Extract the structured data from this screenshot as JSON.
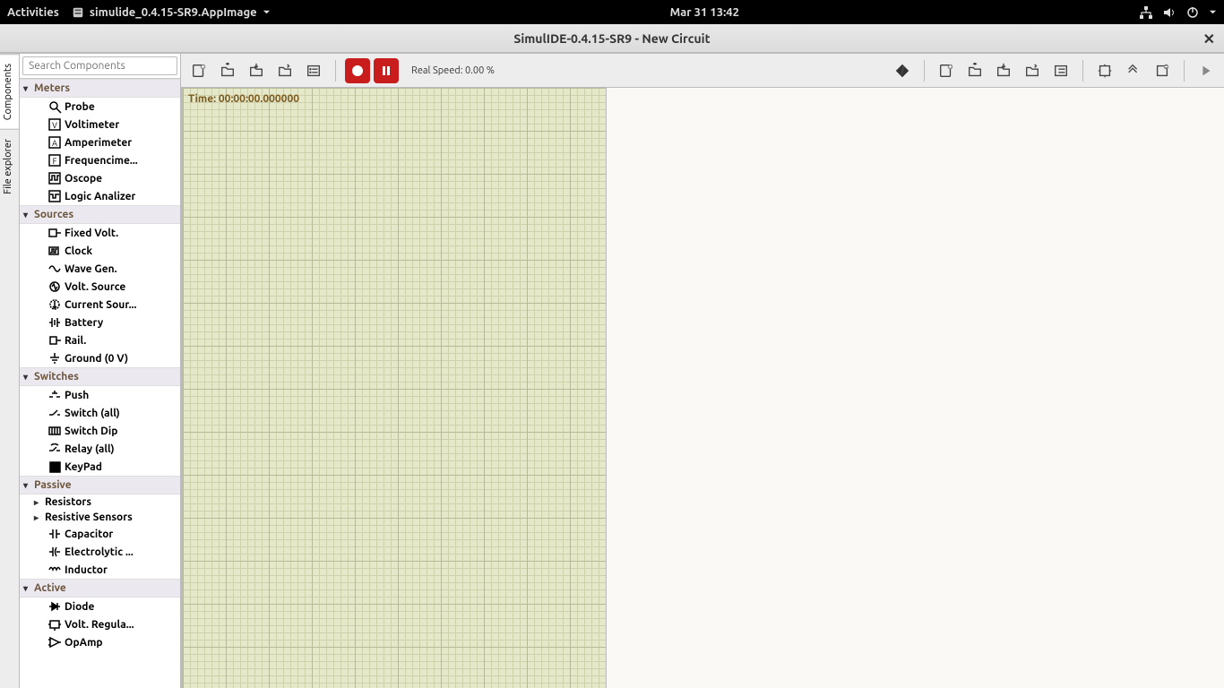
{
  "gnome": {
    "activities": "Activities",
    "app_name": "simulide_0.4.15-SR9.AppImage",
    "clock": "Mar 31  13:42"
  },
  "window": {
    "title": "SimulIDE-0.4.15-SR9  -  New Circuit"
  },
  "side_tabs": {
    "components": "Components",
    "file_explorer": "File explorer"
  },
  "search": {
    "placeholder": "Search Components"
  },
  "tree": [
    {
      "type": "cat",
      "label": "Meters",
      "icon": "meters"
    },
    {
      "type": "item",
      "label": "Probe",
      "icon": "probe"
    },
    {
      "type": "item",
      "label": "Voltimeter",
      "icon": "voltimeter"
    },
    {
      "type": "item",
      "label": "Amperimeter",
      "icon": "amperimeter"
    },
    {
      "type": "item",
      "label": "Frequencime...",
      "icon": "freq"
    },
    {
      "type": "item",
      "label": "Oscope",
      "icon": "oscope"
    },
    {
      "type": "item",
      "label": "Logic Analizer",
      "icon": "logic"
    },
    {
      "type": "cat",
      "label": "Sources",
      "icon": "sources"
    },
    {
      "type": "item",
      "label": "Fixed Volt.",
      "icon": "fixedv"
    },
    {
      "type": "item",
      "label": "Clock",
      "icon": "clock"
    },
    {
      "type": "item",
      "label": "Wave Gen.",
      "icon": "wave"
    },
    {
      "type": "item",
      "label": "Volt. Source",
      "icon": "vsource"
    },
    {
      "type": "item",
      "label": "Current Sour...",
      "icon": "csource"
    },
    {
      "type": "item",
      "label": "Battery",
      "icon": "battery"
    },
    {
      "type": "item",
      "label": "Rail.",
      "icon": "rail"
    },
    {
      "type": "item",
      "label": "Ground (0 V)",
      "icon": "ground"
    },
    {
      "type": "cat",
      "label": "Switches",
      "icon": "switches"
    },
    {
      "type": "item",
      "label": "Push",
      "icon": "push"
    },
    {
      "type": "item",
      "label": "Switch (all)",
      "icon": "switch"
    },
    {
      "type": "item",
      "label": "Switch Dip",
      "icon": "dip"
    },
    {
      "type": "item",
      "label": "Relay (all)",
      "icon": "relay"
    },
    {
      "type": "item",
      "label": "KeyPad",
      "icon": "keypad"
    },
    {
      "type": "cat",
      "label": "Passive",
      "icon": "passive"
    },
    {
      "type": "subcat",
      "label": "Resistors",
      "icon": "resistors"
    },
    {
      "type": "subcat",
      "label": "Resistive Sensors",
      "icon": "rsensors"
    },
    {
      "type": "item",
      "label": "Capacitor",
      "icon": "cap"
    },
    {
      "type": "item",
      "label": "Electrolytic ...",
      "icon": "ecap"
    },
    {
      "type": "item",
      "label": "Inductor",
      "icon": "inductor"
    },
    {
      "type": "cat",
      "label": "Active",
      "icon": "active"
    },
    {
      "type": "item",
      "label": "Diode",
      "icon": "diode"
    },
    {
      "type": "item",
      "label": "Volt. Regula...",
      "icon": "vreg"
    },
    {
      "type": "item",
      "label": "OpAmp",
      "icon": "opamp"
    }
  ],
  "toolbar": {
    "real_speed": "Real Speed: 0.00 %"
  },
  "canvas": {
    "time": "Time: 00:00:00.000000"
  }
}
